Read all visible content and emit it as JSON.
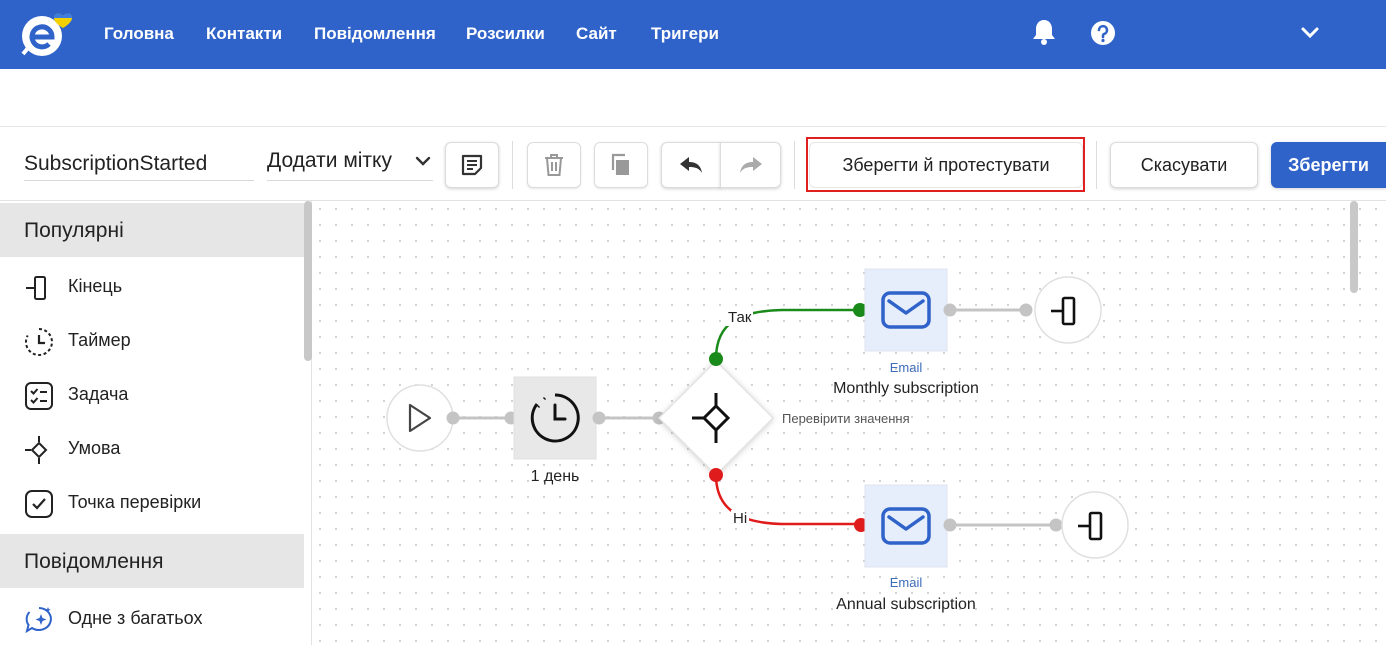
{
  "nav": {
    "items": [
      "Головна",
      "Контакти",
      "Повідомлення",
      "Розсилки",
      "Сайт",
      "Тригери"
    ],
    "icons": [
      "bell-icon",
      "help-icon",
      "chevron-down-icon"
    ],
    "accent": "#2f63c9"
  },
  "toolbar": {
    "flow_name": "SubscriptionStarted",
    "tag_label": "Додати мітку",
    "save_test_label": "Зберегти й протестувати",
    "cancel_label": "Скасувати",
    "save_label": "Зберегти"
  },
  "sidebar": {
    "sections": [
      {
        "title": "Популярні",
        "items": [
          {
            "label": "Кінець",
            "icon": "end-icon"
          },
          {
            "label": "Таймер",
            "icon": "timer-icon"
          },
          {
            "label": "Задача",
            "icon": "task-icon"
          },
          {
            "label": "Умова",
            "icon": "condition-icon"
          },
          {
            "label": "Точка перевірки",
            "icon": "checkpoint-icon"
          }
        ]
      },
      {
        "title": "Повідомлення",
        "items": [
          {
            "label": "Одне з багатьох",
            "icon": "sparkle-chat-icon"
          }
        ]
      }
    ]
  },
  "flow": {
    "timer_label": "1 день",
    "condition_label": "Перевірити значення",
    "yes_label": "Так",
    "no_label": "Ні",
    "email_type": "Email",
    "email_top_label": "Monthly subscription",
    "email_bottom_label": "Annual subscription",
    "yes_color": "#1a8a1a",
    "no_color": "#e01b1b"
  }
}
